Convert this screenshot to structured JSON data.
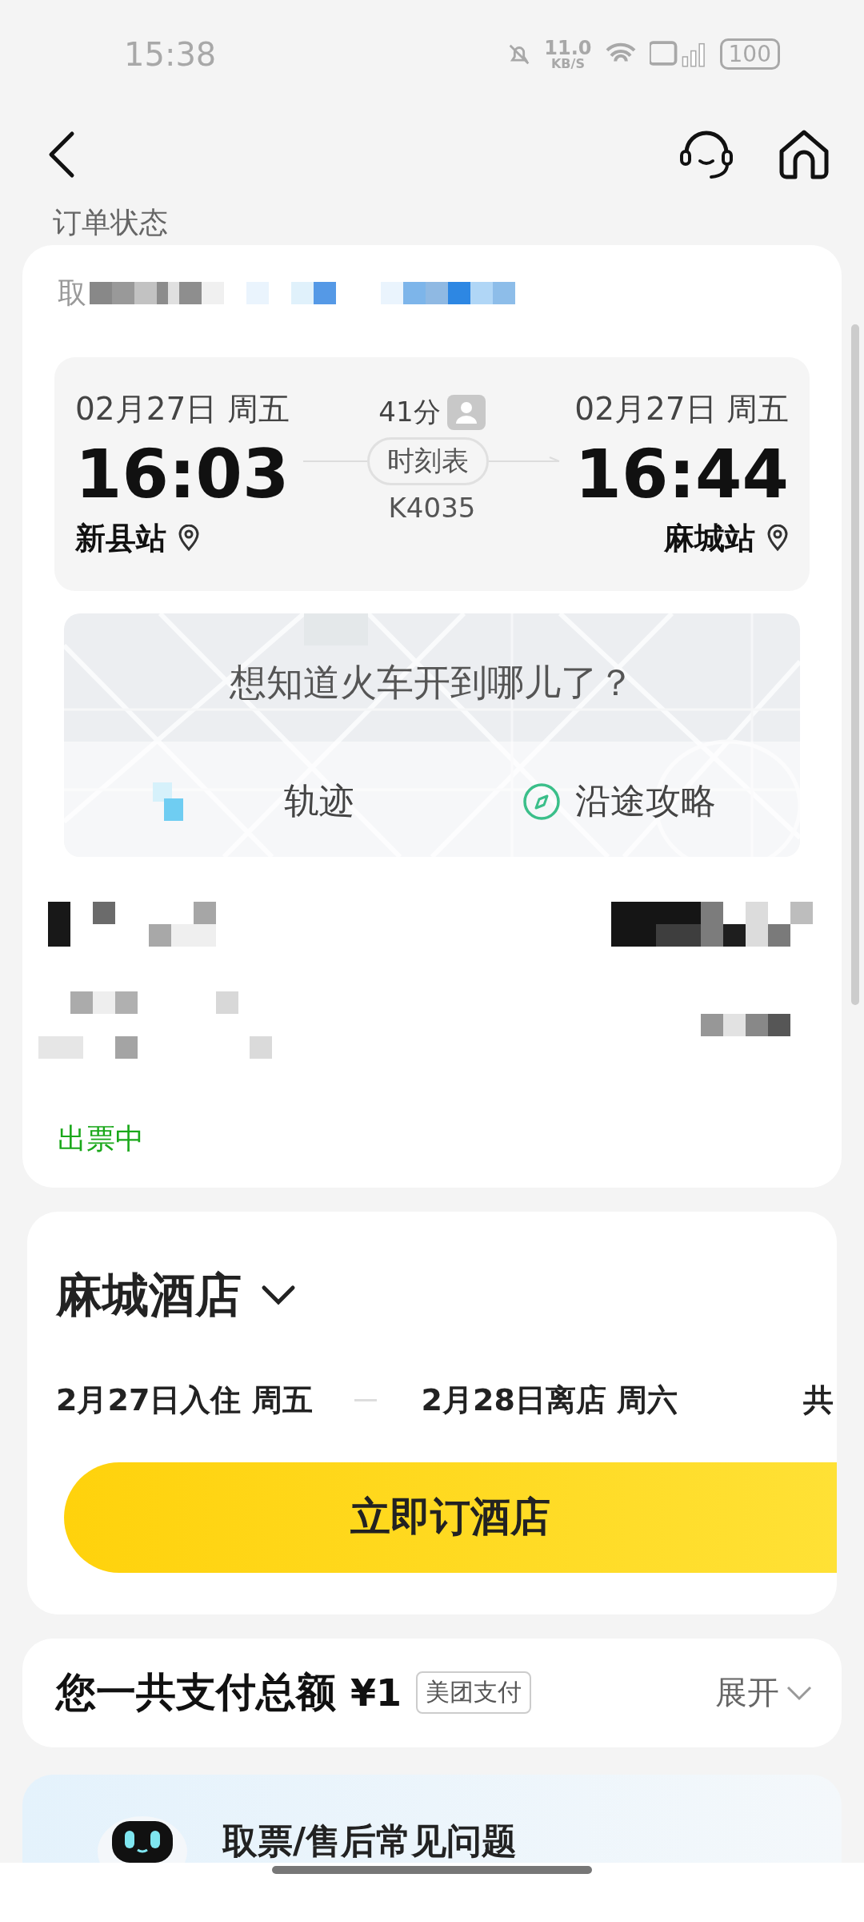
{
  "status_bar": {
    "time": "15:38",
    "net_speed": "11.0",
    "net_unit": "KB/S",
    "battery": "100"
  },
  "header": {
    "section_title": "订单状态"
  },
  "order_card": {
    "pickup_label": "取",
    "departure": {
      "date": "02月27日 周五",
      "time": "16:03",
      "station": "新县站"
    },
    "duration": "41分",
    "timetable_button": "时刻表",
    "train_number": "K4035",
    "arrival": {
      "date": "02月27日 周五",
      "time": "16:44",
      "station": "麻城站"
    },
    "map_prompt": "想知道火车开到哪儿了？",
    "map_actions": [
      {
        "kind": "track",
        "label": "轨迹"
      },
      {
        "kind": "guide",
        "label": "沿途攻略"
      }
    ],
    "ticket_status": "出票中"
  },
  "hotel_card": {
    "title": "麻城酒店",
    "check_in": "2月27日入住 周五",
    "check_out": "2月28日离店 周六",
    "nights": "共",
    "book_button": "立即订酒店"
  },
  "payment": {
    "label": "您一共支付总额",
    "amount": "¥1",
    "method_tag": "美团支付",
    "expand": "展开"
  },
  "faq": {
    "title": "取票/售后常见问题"
  }
}
